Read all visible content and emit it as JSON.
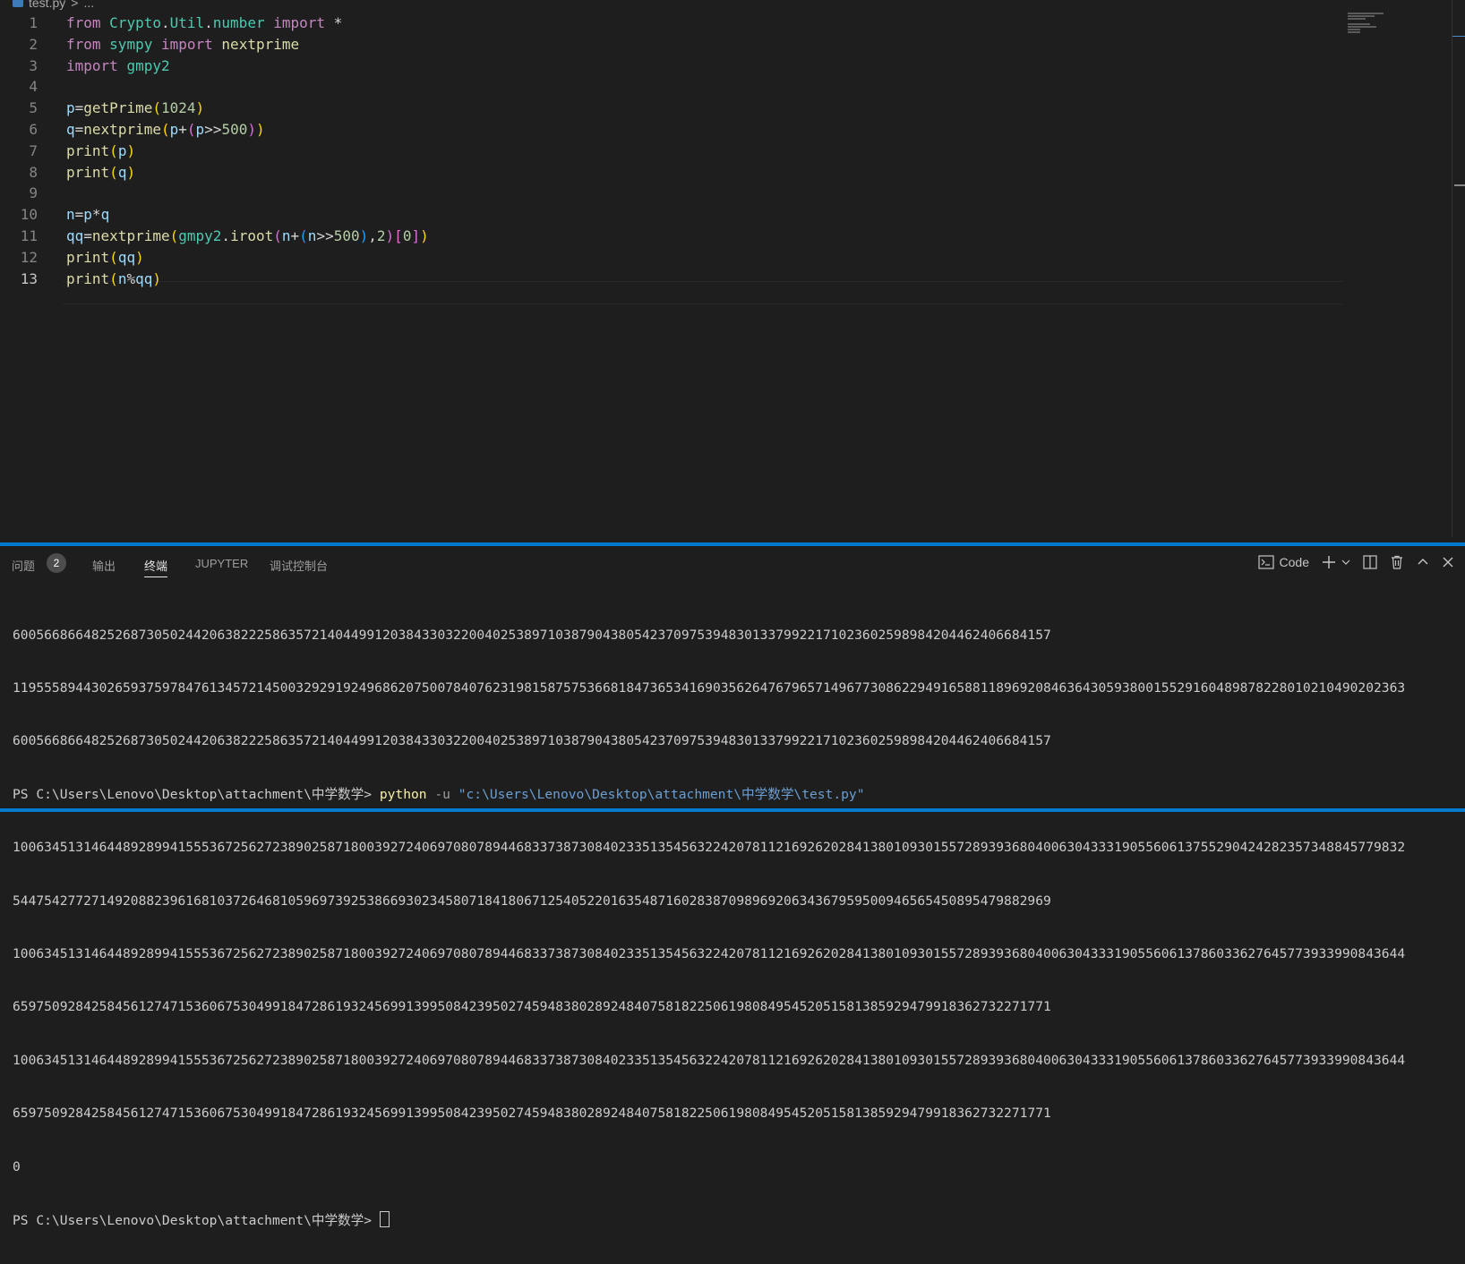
{
  "breadcrumb": {
    "file": "test.py",
    "sep": ">",
    "rest": "..."
  },
  "editor": {
    "line_numbers": [
      "1",
      "2",
      "3",
      "4",
      "5",
      "6",
      "7",
      "8",
      "9",
      "10",
      "11",
      "12",
      "13"
    ],
    "active_line": 13
  },
  "panel": {
    "tabs": {
      "problems": "问题",
      "problems_count": "2",
      "output": "输出",
      "terminal": "终端",
      "jupyter": "JUPYTER",
      "debug_console": "调试控制台"
    },
    "actions": {
      "shell_label": "Code"
    }
  },
  "terminal": {
    "lines": [
      "60056686648252687305024420638222586357214044991203843303220040253897103879043805423709753948301337992217102360259898420446240668415​7",
      "11955589443026593759784761345721450032929192496862075007840762319815875753668184736534169035626476796571496773086229491658811896920846364305938001552916048987822801021049020236​3",
      "60056686648252687305024420638222586357214044991203843303220040253897103879043805423709753948301337992217102360259898420446240668415​7"
    ],
    "prompt_path": "PS C:\\Users\\Lenovo\\Desktop\\attachment\\中学数学>",
    "cmd_exe": "python",
    "cmd_flag": "-u",
    "cmd_arg": "\"c:\\Users\\Lenovo\\Desktop\\attachment\\中学数学\\test.py\"",
    "out_lines": [
      "100634513146448928994155536725627238902587180039272406970807894468337387308402335135456322420781121692620284138010930155728939368040063043331905560613755290424282357348845779832",
      "5447542772714920882396168103726468105969739253866930234580718418067125405220163548716028387098969206343679595009465654508954798829​69",
      "100634513146448928994155536725627238902587180039272406970807894468337387308402335135456322420781121692620284138010930155728939368040063043331905560613786033627645773933990843644",
      "6597509284258456127471536067530499184728619324569913995084239502745948380289248407581822506198084954520515813859294799183627322717​71",
      "100634513146448928994155536725627238902587180039272406970807894468337387308402335135456322420781121692620284138010930155728939368040063043331905560613786033627645773933990843644",
      "6597509284258456127471536067530499184728619324569913995084239502745948380289248407581822506198084954520515813859294799183627322717​71",
      "0"
    ],
    "final_prompt": "PS C:\\Users\\Lenovo\\Desktop\\attachment\\中学数学>"
  }
}
